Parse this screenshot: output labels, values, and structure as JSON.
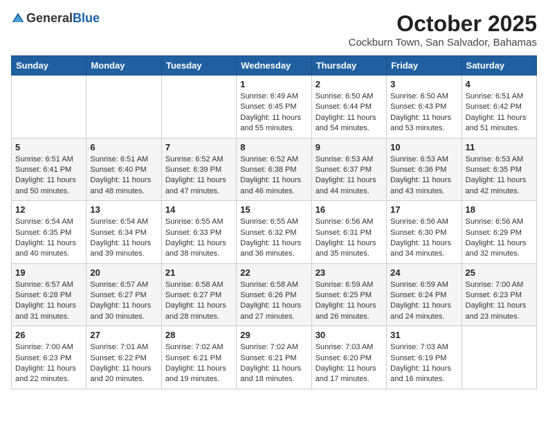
{
  "header": {
    "logo_general": "General",
    "logo_blue": "Blue",
    "month_title": "October 2025",
    "subtitle": "Cockburn Town, San Salvador, Bahamas"
  },
  "days_of_week": [
    "Sunday",
    "Monday",
    "Tuesday",
    "Wednesday",
    "Thursday",
    "Friday",
    "Saturday"
  ],
  "weeks": [
    [
      {
        "day": "",
        "info": ""
      },
      {
        "day": "",
        "info": ""
      },
      {
        "day": "",
        "info": ""
      },
      {
        "day": "1",
        "info": "Sunrise: 6:49 AM\nSunset: 6:45 PM\nDaylight: 11 hours and 55 minutes."
      },
      {
        "day": "2",
        "info": "Sunrise: 6:50 AM\nSunset: 6:44 PM\nDaylight: 11 hours and 54 minutes."
      },
      {
        "day": "3",
        "info": "Sunrise: 6:50 AM\nSunset: 6:43 PM\nDaylight: 11 hours and 53 minutes."
      },
      {
        "day": "4",
        "info": "Sunrise: 6:51 AM\nSunset: 6:42 PM\nDaylight: 11 hours and 51 minutes."
      }
    ],
    [
      {
        "day": "5",
        "info": "Sunrise: 6:51 AM\nSunset: 6:41 PM\nDaylight: 11 hours and 50 minutes."
      },
      {
        "day": "6",
        "info": "Sunrise: 6:51 AM\nSunset: 6:40 PM\nDaylight: 11 hours and 48 minutes."
      },
      {
        "day": "7",
        "info": "Sunrise: 6:52 AM\nSunset: 6:39 PM\nDaylight: 11 hours and 47 minutes."
      },
      {
        "day": "8",
        "info": "Sunrise: 6:52 AM\nSunset: 6:38 PM\nDaylight: 11 hours and 46 minutes."
      },
      {
        "day": "9",
        "info": "Sunrise: 6:53 AM\nSunset: 6:37 PM\nDaylight: 11 hours and 44 minutes."
      },
      {
        "day": "10",
        "info": "Sunrise: 6:53 AM\nSunset: 6:36 PM\nDaylight: 11 hours and 43 minutes."
      },
      {
        "day": "11",
        "info": "Sunrise: 6:53 AM\nSunset: 6:35 PM\nDaylight: 11 hours and 42 minutes."
      }
    ],
    [
      {
        "day": "12",
        "info": "Sunrise: 6:54 AM\nSunset: 6:35 PM\nDaylight: 11 hours and 40 minutes."
      },
      {
        "day": "13",
        "info": "Sunrise: 6:54 AM\nSunset: 6:34 PM\nDaylight: 11 hours and 39 minutes."
      },
      {
        "day": "14",
        "info": "Sunrise: 6:55 AM\nSunset: 6:33 PM\nDaylight: 11 hours and 38 minutes."
      },
      {
        "day": "15",
        "info": "Sunrise: 6:55 AM\nSunset: 6:32 PM\nDaylight: 11 hours and 36 minutes."
      },
      {
        "day": "16",
        "info": "Sunrise: 6:56 AM\nSunset: 6:31 PM\nDaylight: 11 hours and 35 minutes."
      },
      {
        "day": "17",
        "info": "Sunrise: 6:56 AM\nSunset: 6:30 PM\nDaylight: 11 hours and 34 minutes."
      },
      {
        "day": "18",
        "info": "Sunrise: 6:56 AM\nSunset: 6:29 PM\nDaylight: 11 hours and 32 minutes."
      }
    ],
    [
      {
        "day": "19",
        "info": "Sunrise: 6:57 AM\nSunset: 6:28 PM\nDaylight: 11 hours and 31 minutes."
      },
      {
        "day": "20",
        "info": "Sunrise: 6:57 AM\nSunset: 6:27 PM\nDaylight: 11 hours and 30 minutes."
      },
      {
        "day": "21",
        "info": "Sunrise: 6:58 AM\nSunset: 6:27 PM\nDaylight: 11 hours and 28 minutes."
      },
      {
        "day": "22",
        "info": "Sunrise: 6:58 AM\nSunset: 6:26 PM\nDaylight: 11 hours and 27 minutes."
      },
      {
        "day": "23",
        "info": "Sunrise: 6:59 AM\nSunset: 6:25 PM\nDaylight: 11 hours and 26 minutes."
      },
      {
        "day": "24",
        "info": "Sunrise: 6:59 AM\nSunset: 6:24 PM\nDaylight: 11 hours and 24 minutes."
      },
      {
        "day": "25",
        "info": "Sunrise: 7:00 AM\nSunset: 6:23 PM\nDaylight: 11 hours and 23 minutes."
      }
    ],
    [
      {
        "day": "26",
        "info": "Sunrise: 7:00 AM\nSunset: 6:23 PM\nDaylight: 11 hours and 22 minutes."
      },
      {
        "day": "27",
        "info": "Sunrise: 7:01 AM\nSunset: 6:22 PM\nDaylight: 11 hours and 20 minutes."
      },
      {
        "day": "28",
        "info": "Sunrise: 7:02 AM\nSunset: 6:21 PM\nDaylight: 11 hours and 19 minutes."
      },
      {
        "day": "29",
        "info": "Sunrise: 7:02 AM\nSunset: 6:21 PM\nDaylight: 11 hours and 18 minutes."
      },
      {
        "day": "30",
        "info": "Sunrise: 7:03 AM\nSunset: 6:20 PM\nDaylight: 11 hours and 17 minutes."
      },
      {
        "day": "31",
        "info": "Sunrise: 7:03 AM\nSunset: 6:19 PM\nDaylight: 11 hours and 16 minutes."
      },
      {
        "day": "",
        "info": ""
      }
    ]
  ]
}
